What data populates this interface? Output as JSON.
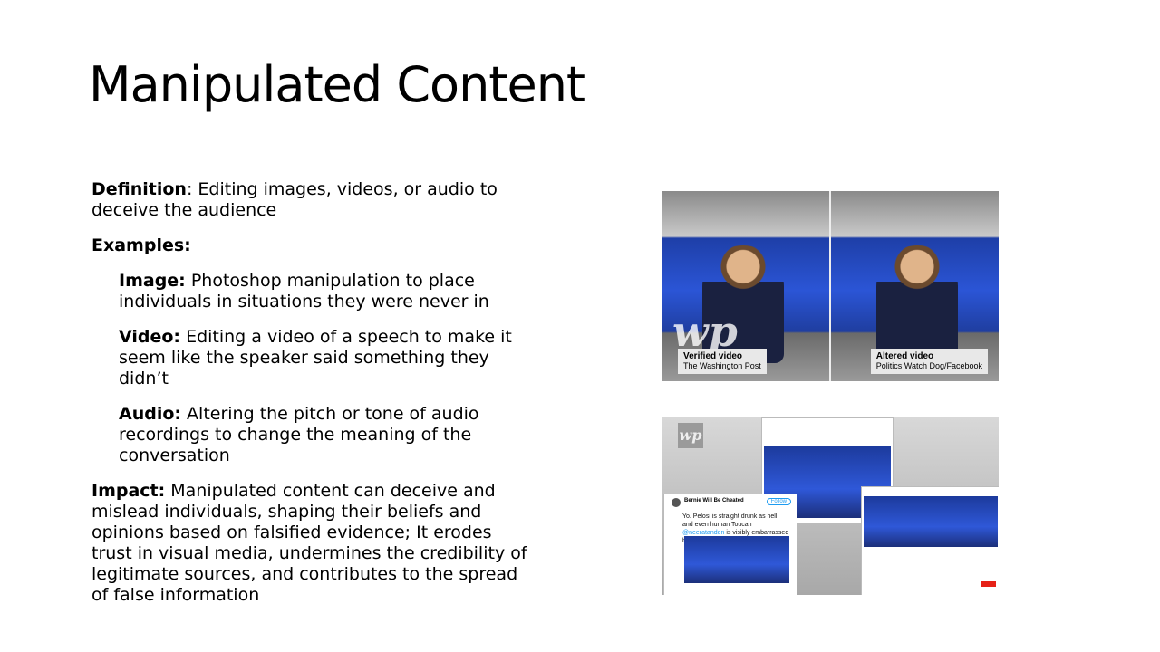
{
  "slide": {
    "title": "Manipulated Content",
    "definition": {
      "label": "Definition",
      "text": ": Editing images, videos, or audio to deceive the audience"
    },
    "examples_label": "Examples:",
    "examples": [
      {
        "label": "Image:",
        "text": " Photoshop manipulation to place individuals in situations they were never in"
      },
      {
        "label": "Video:",
        "text": " Editing a video of a speech to make it seem like the speaker said something they didn’t"
      },
      {
        "label": "Audio:",
        "text": " Altering the pitch or tone of audio recordings to change the meaning of the conversation"
      }
    ],
    "impact": {
      "label": "Impact:",
      "text": " Manipulated content can deceive and mislead individuals, shaping their beliefs and opinions based on falsified evidence; It erodes trust in visual media, undermines the credibility of legitimate sources, and contributes to the spread of false information"
    }
  },
  "image1": {
    "verified_title": "Verified video",
    "verified_source": "The Washington Post",
    "altered_title": "Altered video",
    "altered_source": "Politics Watch Dog/Facebook",
    "watermark": "wp"
  },
  "image2": {
    "watermark": "wp",
    "tweet_author": "Bernie Will Be Cheated",
    "follow_label": "Follow",
    "tweet_text_start": "Yo. Pelosi is straight drunk as hell and even human Toucan ",
    "tweet_mention": "@neeratanden",
    "tweet_text_end": " is visibly embarrassed by her stupor."
  }
}
